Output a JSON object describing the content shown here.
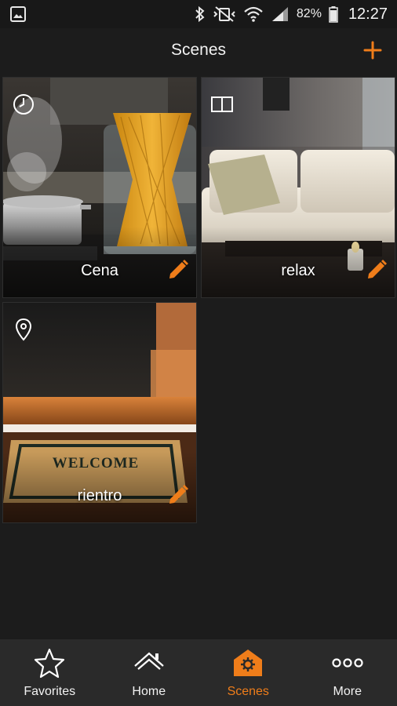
{
  "status_bar": {
    "battery_percent": "82%",
    "time": "12:27",
    "icons": [
      "gallery-notification-icon",
      "bluetooth-icon",
      "vibrate-icon",
      "wifi-icon",
      "signal-icon",
      "battery-icon"
    ]
  },
  "header": {
    "title": "Scenes",
    "add_icon": "plus-icon"
  },
  "scenes": [
    {
      "label": "Cena",
      "type_icon": "clock-icon",
      "edit_icon": "pencil-icon"
    },
    {
      "label": "relax",
      "type_icon": "manual-scene-icon",
      "edit_icon": "pencil-icon"
    },
    {
      "label": "rientro",
      "type_icon": "location-pin-icon",
      "edit_icon": "pencil-icon"
    }
  ],
  "bottom_nav": {
    "items": [
      {
        "label": "Favorites",
        "icon": "star-icon",
        "active": false
      },
      {
        "label": "Home",
        "icon": "house-icon",
        "active": false
      },
      {
        "label": "Scenes",
        "icon": "scenes-icon",
        "active": true
      },
      {
        "label": "More",
        "icon": "more-dots-icon",
        "active": false
      }
    ]
  },
  "colors": {
    "accent": "#ef7d1a",
    "background": "#1c1c1c",
    "nav_background": "#2a2a2a",
    "text": "#ffffff"
  }
}
